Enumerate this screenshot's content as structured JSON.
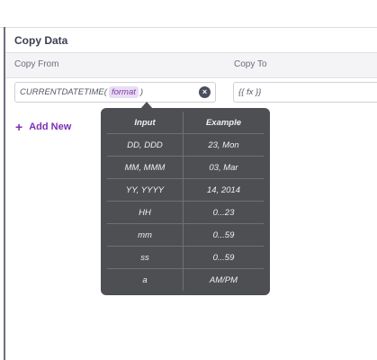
{
  "section": {
    "title": "Copy Data"
  },
  "columns": {
    "from_label": "Copy From",
    "to_label": "Copy To"
  },
  "copy_from_field": {
    "prefix": "CURRENTDATETIME(",
    "token": "format",
    "suffix": ")",
    "clear_icon": "close-circle-icon"
  },
  "copy_to_field": {
    "value": "{{ fx }}"
  },
  "add_new": {
    "icon": "plus-icon",
    "label": "Add New"
  },
  "format_tooltip": {
    "headers": {
      "input": "Input",
      "example": "Example"
    },
    "rows": [
      {
        "input": "DD, DDD",
        "example": "23, Mon"
      },
      {
        "input": "MM, MMM",
        "example": "03, Mar"
      },
      {
        "input": "YY, YYYY",
        "example": "14, 2014"
      },
      {
        "input": "HH",
        "example": "0...23"
      },
      {
        "input": "mm",
        "example": "0...59"
      },
      {
        "input": "ss",
        "example": "0...59"
      },
      {
        "input": "a",
        "example": "AM/PM"
      }
    ]
  }
}
